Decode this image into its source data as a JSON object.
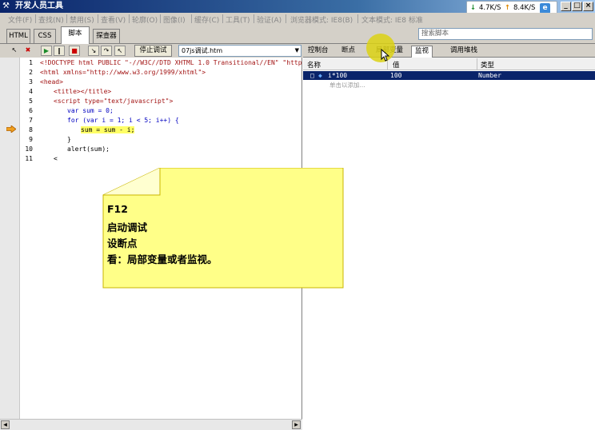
{
  "window": {
    "title": "开发人员工具"
  },
  "speed": {
    "down": "4.7K/S",
    "up": "8.4K/S"
  },
  "menu": {
    "items": [
      "文件(F)",
      "查找(N)",
      "禁用(S)",
      "查看(V)",
      "轮廓(O)",
      "图像(I)",
      "缓存(C)",
      "工具(T)",
      "验证(A)",
      "浏览器模式: IE8(B)",
      "文本模式: IE8 标准"
    ]
  },
  "tabs": [
    "HTML",
    "CSS",
    "脚本",
    "探查器"
  ],
  "search": {
    "placeholder": "搜索脚本"
  },
  "toolbar": {
    "stop_debug": "停止调试",
    "file": "07js调试.htm"
  },
  "right_tabs": [
    "控制台",
    "断点",
    "局部变量",
    "监视",
    "调用堆栈"
  ],
  "locals": {
    "columns": [
      "名称",
      "值",
      "类型"
    ],
    "rows": [
      {
        "name": "i*100",
        "value": "100",
        "type": "Number"
      }
    ],
    "add_hint": "单击以添加..."
  },
  "code": {
    "lines": [
      "1",
      "2",
      "3",
      "4",
      "5",
      "6",
      "7",
      "8",
      "9",
      "10",
      "11"
    ],
    "l1": "<!DOCTYPE html PUBLIC \"-//W3C//DTD XHTML 1.0 Transitional//EN\" \"http://www.",
    "l2": "<html xmlns=\"http://www.w3.org/1999/xhtml\">",
    "l3": "<head>",
    "l4": "<title></title>",
    "l5": "<script type=\"text/javascript\">",
    "l6": "var sum = 0;",
    "l7": "for (var i = 1; i < 5; i++) {",
    "l8": "sum = sum - i;",
    "l8_after": "",
    "l9": "}",
    "l10": "alert(sum);",
    "l11": "<"
  },
  "note": {
    "lines": [
      "F12",
      "启动调试",
      "设断点",
      "看：局部变量或者监视。"
    ]
  },
  "colors": {
    "note_fill": "#ffff88",
    "highlight": "#ffff66",
    "selected_row": "#0a246a"
  }
}
